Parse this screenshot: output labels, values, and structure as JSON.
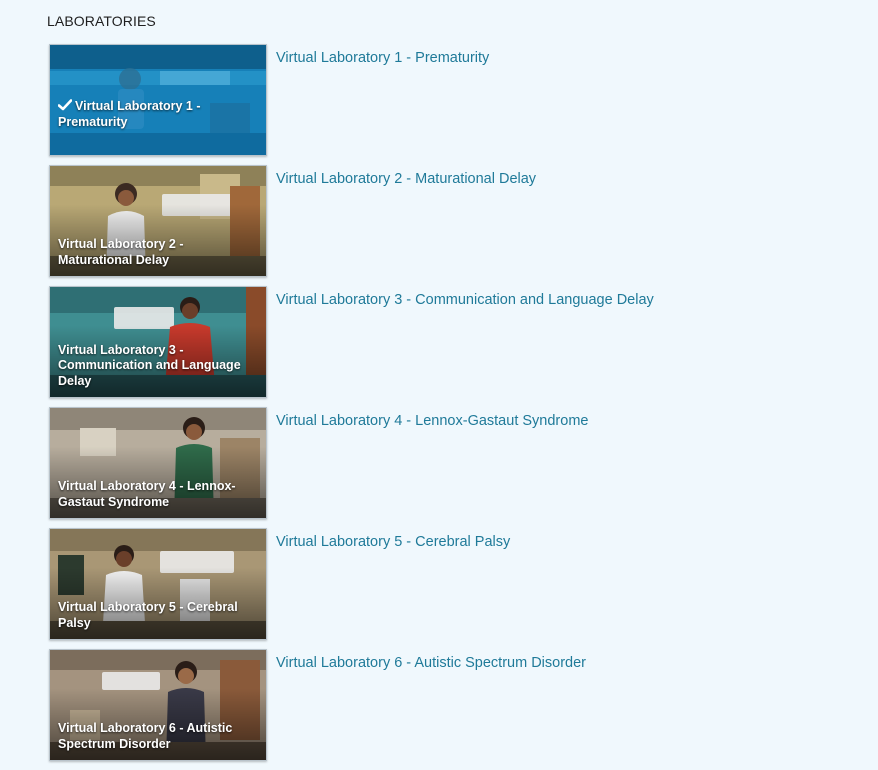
{
  "section": {
    "title": "LABORATORIES"
  },
  "labs": [
    {
      "thumb_caption": "Virtual Laboratory 1 - Prematurity",
      "link_label": "Virtual Laboratory 1 - Prematurity",
      "completed": true,
      "check_icon": "check-icon",
      "tint": "#1a7fb4"
    },
    {
      "thumb_caption": "Virtual Laboratory 2 - Maturational Delay",
      "link_label": "Virtual Laboratory 2 - Maturational Delay",
      "completed": false,
      "tint": "#8a7a4a"
    },
    {
      "thumb_caption": "Virtual Laboratory 3 - Communication and Language Delay",
      "link_label": "Virtual Laboratory 3 - Communication and Language Delay",
      "completed": false,
      "tint": "#2f6e73"
    },
    {
      "thumb_caption": "Virtual Laboratory 4 - Lennox-Gastaut Syndrome",
      "link_label": "Virtual Laboratory 4 - Lennox-Gastaut Syndrome",
      "completed": false,
      "tint": "#7a6f60"
    },
    {
      "thumb_caption": "Virtual Laboratory 5 - Cerebral Palsy",
      "link_label": "Virtual Laboratory 5 - Cerebral Palsy",
      "completed": false,
      "tint": "#7a6a52"
    },
    {
      "thumb_caption": "Virtual Laboratory 6 - Autistic Spectrum Disorder",
      "link_label": "Virtual Laboratory 6 - Autistic Spectrum Disorder",
      "completed": false,
      "tint": "#7b6a5a"
    }
  ],
  "colors": {
    "background": "#f0f8fd",
    "link": "#1f7a99",
    "title": "#1f1f1f"
  }
}
